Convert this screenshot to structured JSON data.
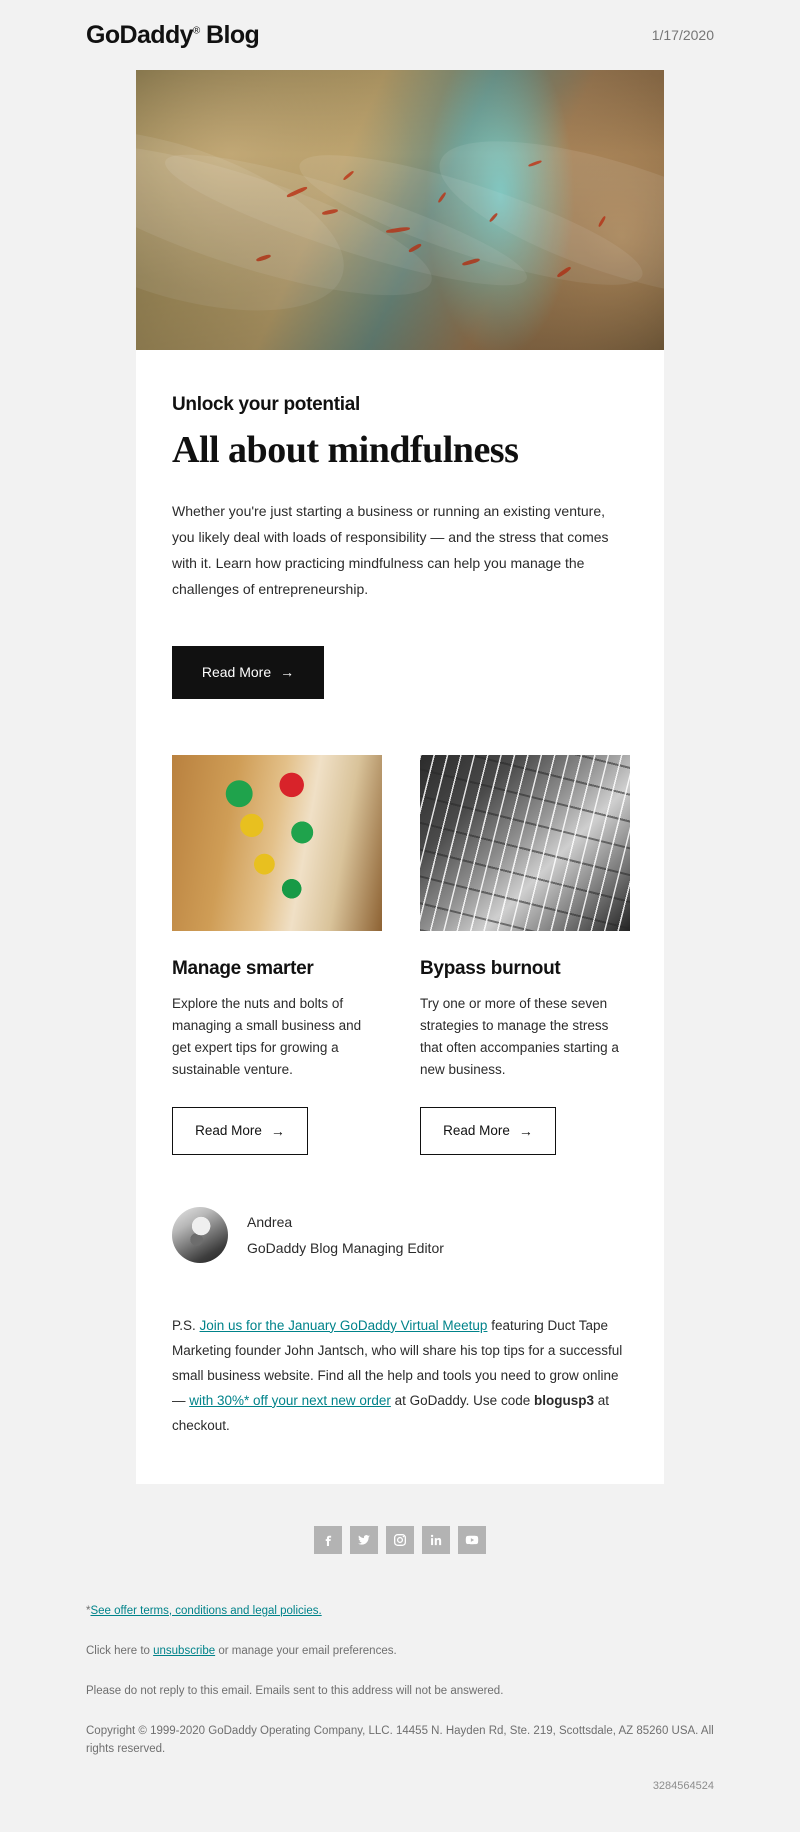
{
  "header": {
    "brand": "GoDaddy",
    "brand_tm": "®",
    "brand_suffix": " Blog",
    "date": "1/17/2020"
  },
  "hero": {
    "image_alt": "abstract blurred warm-toned image with teal highlight"
  },
  "main": {
    "eyebrow": "Unlock your potential",
    "headline": "All about mindfulness",
    "lead": "Whether you're just starting a business or running an existing venture, you likely deal with loads of responsibility — and the stress that comes with it. Learn how practicing mindfulness can help you manage the challenges of entrepreneurship.",
    "cta_label": "Read More",
    "cta_arrow": "→"
  },
  "columns": [
    {
      "image_alt": "colorful wooden pegs toy",
      "title": "Manage smarter",
      "text": "Explore the nuts and bolts of managing a small business and get expert tips for growing a sustainable venture.",
      "cta_label": "Read More",
      "cta_arrow": "→"
    },
    {
      "image_alt": "black and white photo of person playing guitar",
      "title": "Bypass burnout",
      "text": "Try one or more of these seven strategies to manage the stress that often accompanies starting a new business.",
      "cta_label": "Read More",
      "cta_arrow": "→"
    }
  ],
  "author": {
    "name": "Andrea",
    "role": "GoDaddy Blog Managing Editor",
    "avatar_alt": "portrait of Andrea"
  },
  "ps": {
    "prefix": "P.S. ",
    "link1": "Join us for the January GoDaddy Virtual Meetup",
    "mid1": " featuring Duct Tape Marketing founder John Jantsch, who will share his top tips for a successful small business website. Find all the help and tools you need to grow online — ",
    "link2": "with 30%* off your next new order",
    "mid2": " at GoDaddy. Use code ",
    "code": "blogusp3",
    "suffix": " at checkout."
  },
  "social": [
    {
      "name": "facebook",
      "label": "Facebook"
    },
    {
      "name": "twitter",
      "label": "Twitter"
    },
    {
      "name": "instagram",
      "label": "Instagram"
    },
    {
      "name": "linkedin",
      "label": "LinkedIn"
    },
    {
      "name": "youtube",
      "label": "YouTube"
    }
  ],
  "legal": {
    "terms_asterisk": "*",
    "terms_link": "See offer terms, conditions and legal policies.",
    "unsub_prefix": "Click here to ",
    "unsub_link": "unsubscribe",
    "unsub_suffix": " or manage your email preferences.",
    "noreply": "Please do not reply to this email. Emails sent to this address will not be answered.",
    "copyright": "Copyright © 1999-2020 GoDaddy Operating Company, LLC. 14455 N. Hayden Rd, Ste. 219, Scottsdale, AZ 85260 USA. All rights reserved.",
    "reference_number": "3284564524"
  },
  "colors": {
    "page_bg": "#f2f2f2",
    "card_bg": "#ffffff",
    "text": "#2b2b2b",
    "heading": "#111111",
    "link": "#00838a",
    "muted": "#6f6f6f",
    "social_icon_bg": "#b3b3b3",
    "button_bg": "#111111"
  }
}
